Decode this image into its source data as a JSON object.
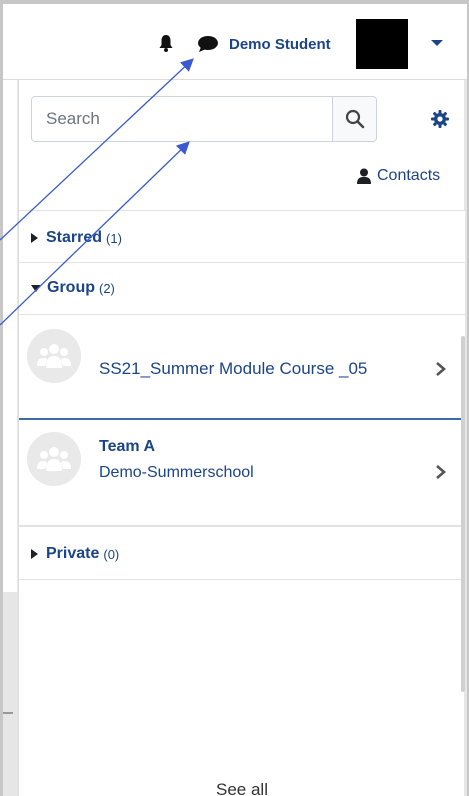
{
  "navbar": {
    "user_name": "Demo Student",
    "icons": [
      "bell-icon",
      "chat-icon",
      "caret-down-icon"
    ]
  },
  "search": {
    "placeholder": "Search",
    "icon": "search-icon",
    "settings_icon": "gear-icon"
  },
  "contacts": {
    "label": "Contacts",
    "icon": "user-icon"
  },
  "sections": {
    "starred": {
      "label": "Starred",
      "count": "(1)"
    },
    "group": {
      "label": "Group",
      "count": "(2)"
    },
    "private": {
      "label": "Private",
      "count": "(0)"
    }
  },
  "conversations": [
    {
      "title": "SS21_Summer Module Course _05",
      "subtitle": ""
    },
    {
      "title": "Team A",
      "subtitle": "Demo-Summerschool"
    }
  ],
  "footer": {
    "see_all": "See all"
  },
  "colors": {
    "link": "#1c4587",
    "annotation_arrow": "#3a5bd0"
  }
}
